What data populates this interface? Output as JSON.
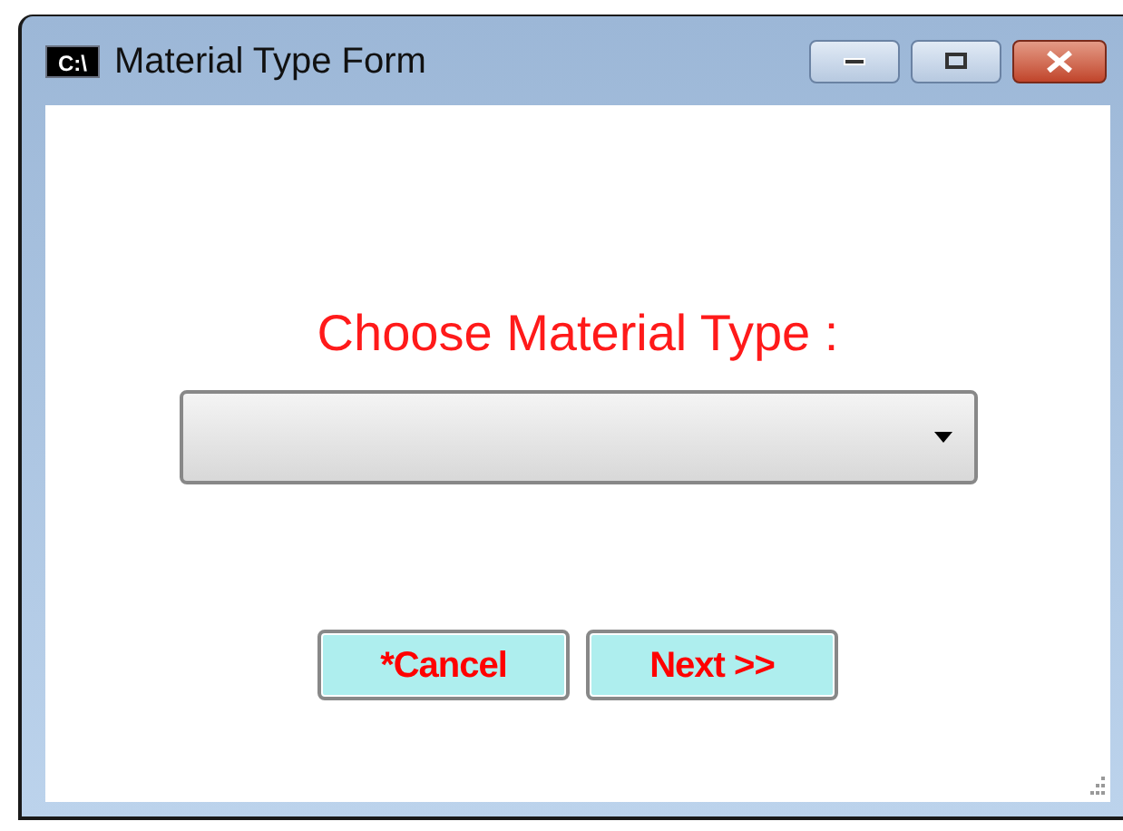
{
  "window": {
    "title": "Material Type Form",
    "icon_text": "C:\\"
  },
  "prompt": "Choose Material Type :",
  "buttons": [
    {
      "label": "*Cancel"
    },
    {
      "label": "Next >>"
    }
  ]
}
